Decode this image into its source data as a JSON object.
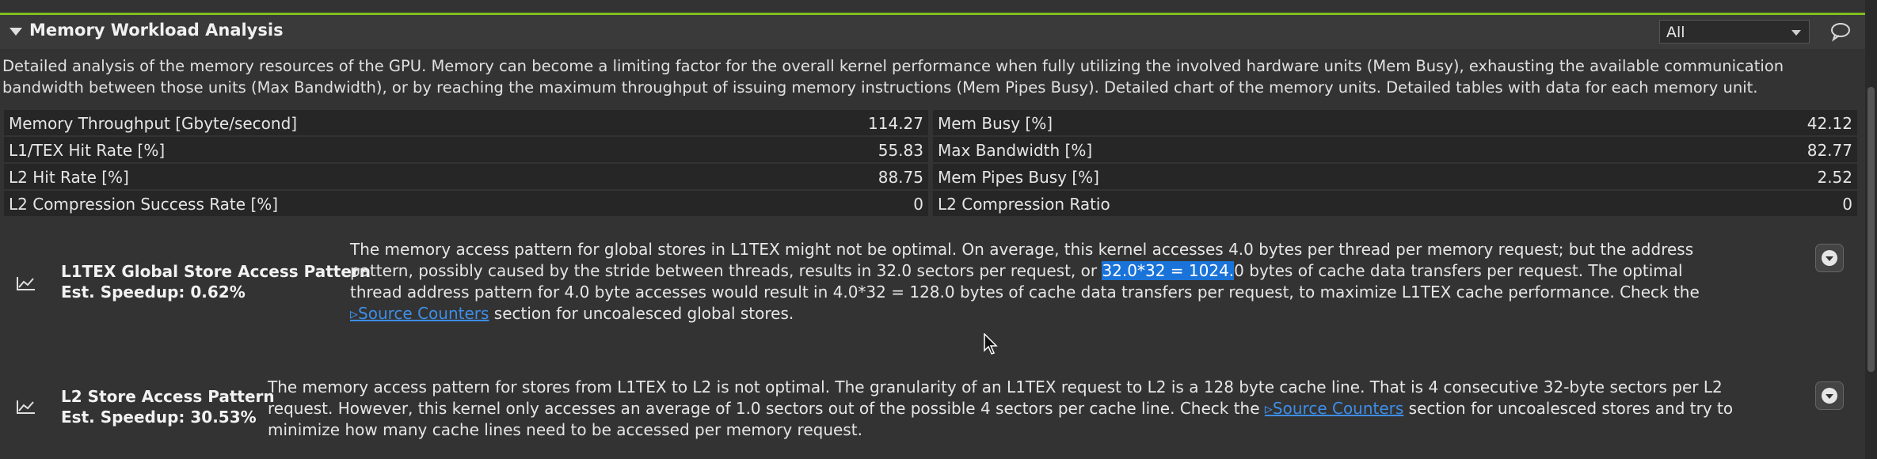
{
  "section": {
    "title": "Memory Workload Analysis",
    "filter_value": "All",
    "description": "Detailed analysis of the memory resources of the GPU. Memory can become a limiting factor for the overall kernel performance when fully utilizing the involved hardware units (Mem Busy), exhausting the available communication bandwidth between those units (Max Bandwidth), or by reaching the maximum throughput of issuing memory instructions (Mem Pipes Busy). Detailed chart of the memory units. Detailed tables with data for each memory unit."
  },
  "metrics": {
    "rows": [
      {
        "left_label": "Memory Throughput [Gbyte/second]",
        "left_value": "114.27",
        "right_label": "Mem Busy [%]",
        "right_value": "42.12"
      },
      {
        "left_label": "L1/TEX Hit Rate [%]",
        "left_value": "55.83",
        "right_label": "Max Bandwidth [%]",
        "right_value": "82.77"
      },
      {
        "left_label": "L2 Hit Rate [%]",
        "left_value": "88.75",
        "right_label": "Mem Pipes Busy [%]",
        "right_value": "2.52"
      },
      {
        "left_label": "L2 Compression Success Rate [%]",
        "left_value": "0",
        "right_label": "L2 Compression Ratio",
        "right_value": "0"
      }
    ]
  },
  "rules": [
    {
      "title": "L1TEX Global Store Access Pattern",
      "speedup": "Est. Speedup: 0.62%",
      "body_pre": "The memory access pattern for global stores in L1TEX might not be optimal. On average, this kernel accesses 4.0 bytes per thread per memory request; but the address pattern, possibly caused by the stride between threads, results in 32.0 sectors per request, or ",
      "body_highlight": "32.0*32 = 1024.",
      "body_mid": "0 bytes of cache data transfers per request. The optimal thread address pattern for 4.0 byte accesses would result in 4.0*32 = 128.0 bytes of cache data transfers per request, to maximize L1TEX cache performance. Check the ",
      "link": "▹Source Counters",
      "body_post": " section for uncoalesced global stores."
    },
    {
      "title": "L2 Store Access Pattern",
      "speedup": "Est. Speedup: 30.53%",
      "body_pre": "The memory access pattern for stores from L1TEX to L2 is not optimal. The granularity of an L1TEX request to L2 is a 128 byte cache line. That is 4 consecutive 32-byte sectors per L2 request. However, this kernel only accesses an average of 1.0 sectors out of the possible 4 sectors per cache line. Check the ",
      "link": "▹Source Counters",
      "body_post": " section for uncoalesced stores and try to minimize how many cache lines need to be accessed per memory request."
    }
  ],
  "icons": {
    "collapse": "triangle-down-icon",
    "filter_caret": "chevron-down-icon",
    "comment": "speech-bubble-icon",
    "rule": "line-chart-icon",
    "rule_toggle": "expand-circle-icon",
    "cursor": "mouse-pointer-icon"
  },
  "colors": {
    "accent_line": "#7fbf1f",
    "link": "#3d8ee8",
    "highlight": "#1a73d9"
  }
}
